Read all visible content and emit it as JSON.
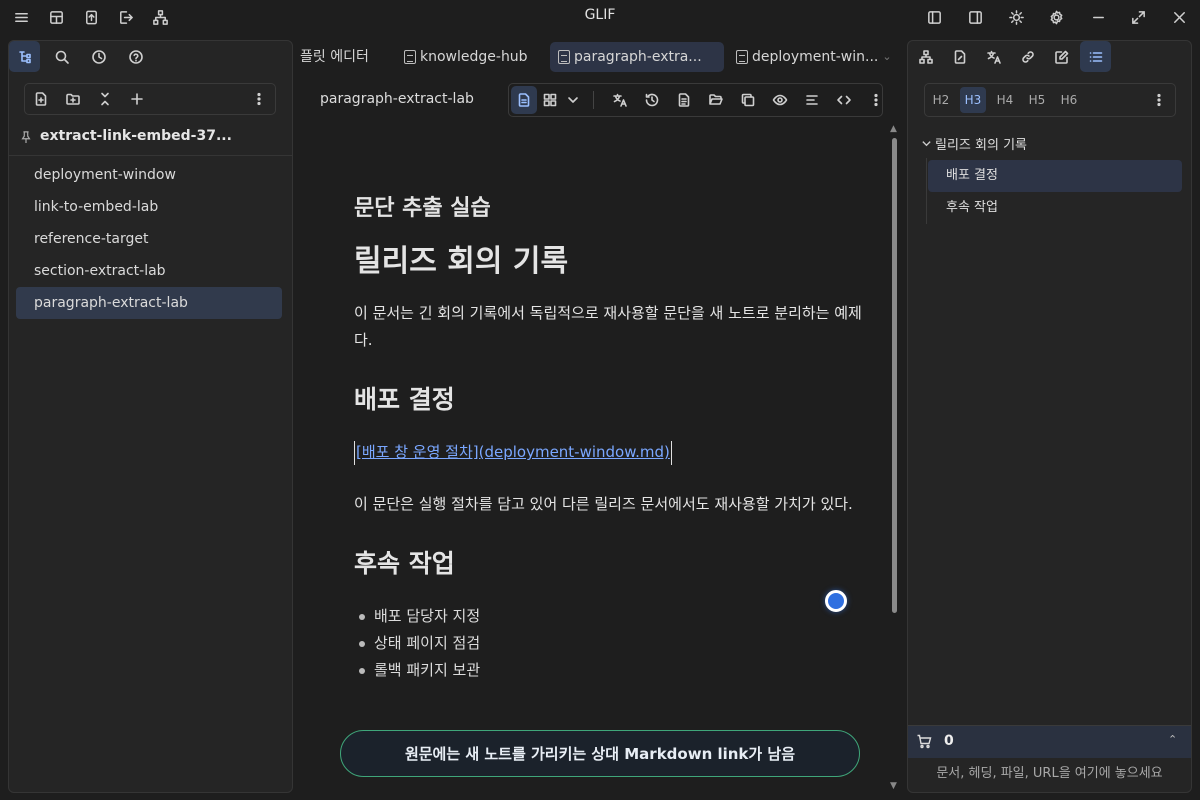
{
  "app": {
    "title": "GLIF"
  },
  "left_panel": {
    "vault_name": "extract-link-embed-37...",
    "files": [
      {
        "label": "deployment-window",
        "active": false
      },
      {
        "label": "link-to-embed-lab",
        "active": false
      },
      {
        "label": "reference-target",
        "active": false
      },
      {
        "label": "section-extract-lab",
        "active": false
      },
      {
        "label": "paragraph-extract-lab",
        "active": true
      }
    ]
  },
  "tabs": [
    {
      "label": "플릿 에디터",
      "active": false
    },
    {
      "label": "knowledge-hub",
      "active": false
    },
    {
      "label": "paragraph-extra...",
      "active": true
    },
    {
      "label": "deployment-win...",
      "active": false
    }
  ],
  "editor": {
    "note_title": "paragraph-extract-lab",
    "content": {
      "subtitle": "문단 추출 실습",
      "h1": "릴리즈 회의 기록",
      "intro": "이 문서는 긴 회의 기록에서 독립적으로 재사용할 문단을 새 노트로 분리하는 예제다.",
      "section1": "배포 결정",
      "link_text": "[배포 창 운영 절차](deployment-window.md)",
      "para2": "이 문단은 실행 절차를 담고 있어 다른 릴리즈 문서에서도 재사용할 가치가 있다.",
      "section2": "후속 작업",
      "bullets": [
        "배포 담당자 지정",
        "상태 페이지 점검",
        "롤백 패키지 보관"
      ]
    },
    "toast": "원문에는 새 노트를 가리키는 상대 Markdown link가 남음"
  },
  "right_panel": {
    "heading_levels": [
      "H2",
      "H3",
      "H4",
      "H5",
      "H6"
    ],
    "active_level": "H3",
    "outline_root": "릴리즈 회의 기록",
    "outline_items": [
      {
        "label": "배포 결정",
        "active": true
      },
      {
        "label": "후속 작업",
        "active": false
      }
    ],
    "basket_count": "0",
    "drop_hint": "문서, 헤딩, 파일, URL을 여기에 놓으세요"
  },
  "colors": {
    "accent": "#2f6fe0",
    "active_bg": "#2d3446",
    "toast_border": "#3fa67a"
  }
}
